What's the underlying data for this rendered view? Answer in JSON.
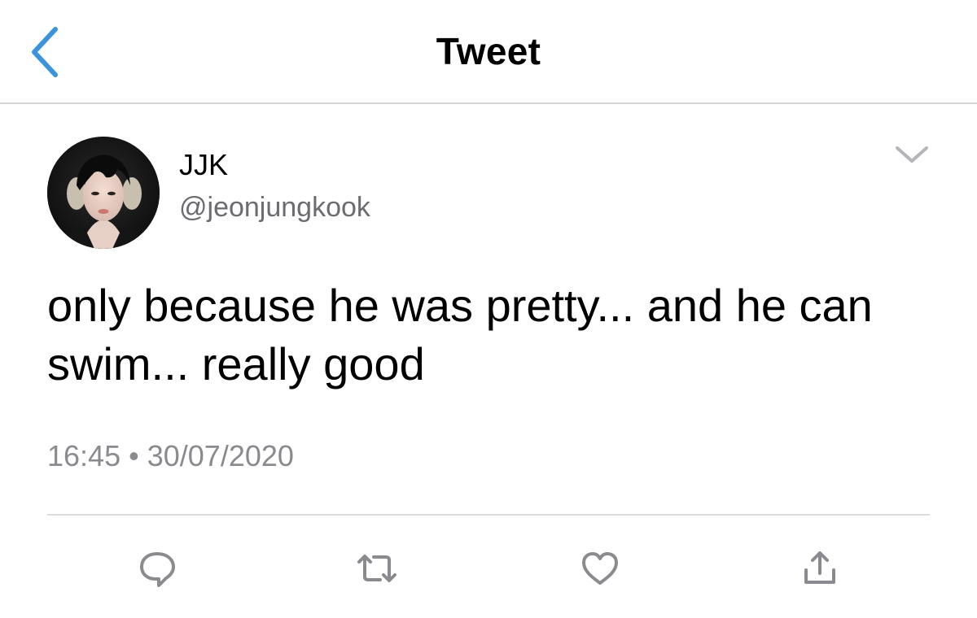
{
  "nav": {
    "title": "Tweet",
    "back_icon": "chevron-left-icon",
    "accent": "#3b94d9"
  },
  "tweet": {
    "author": {
      "display_name": "JJK",
      "handle": "@jeonjungkook",
      "avatar_icon": "profile-photo"
    },
    "text": "only because he was pretty... and he can swim... really good",
    "time": "16:45",
    "separator": "•",
    "date": "30/07/2020"
  },
  "actions": [
    {
      "name": "reply",
      "icon": "speech-bubble-icon"
    },
    {
      "name": "retweet",
      "icon": "retweet-icon"
    },
    {
      "name": "like",
      "icon": "heart-icon"
    },
    {
      "name": "share",
      "icon": "share-icon"
    }
  ],
  "colors": {
    "icon_gray": "#8a8a8f",
    "text_secondary": "#6b6b70",
    "divider": "#dcdcdf"
  }
}
